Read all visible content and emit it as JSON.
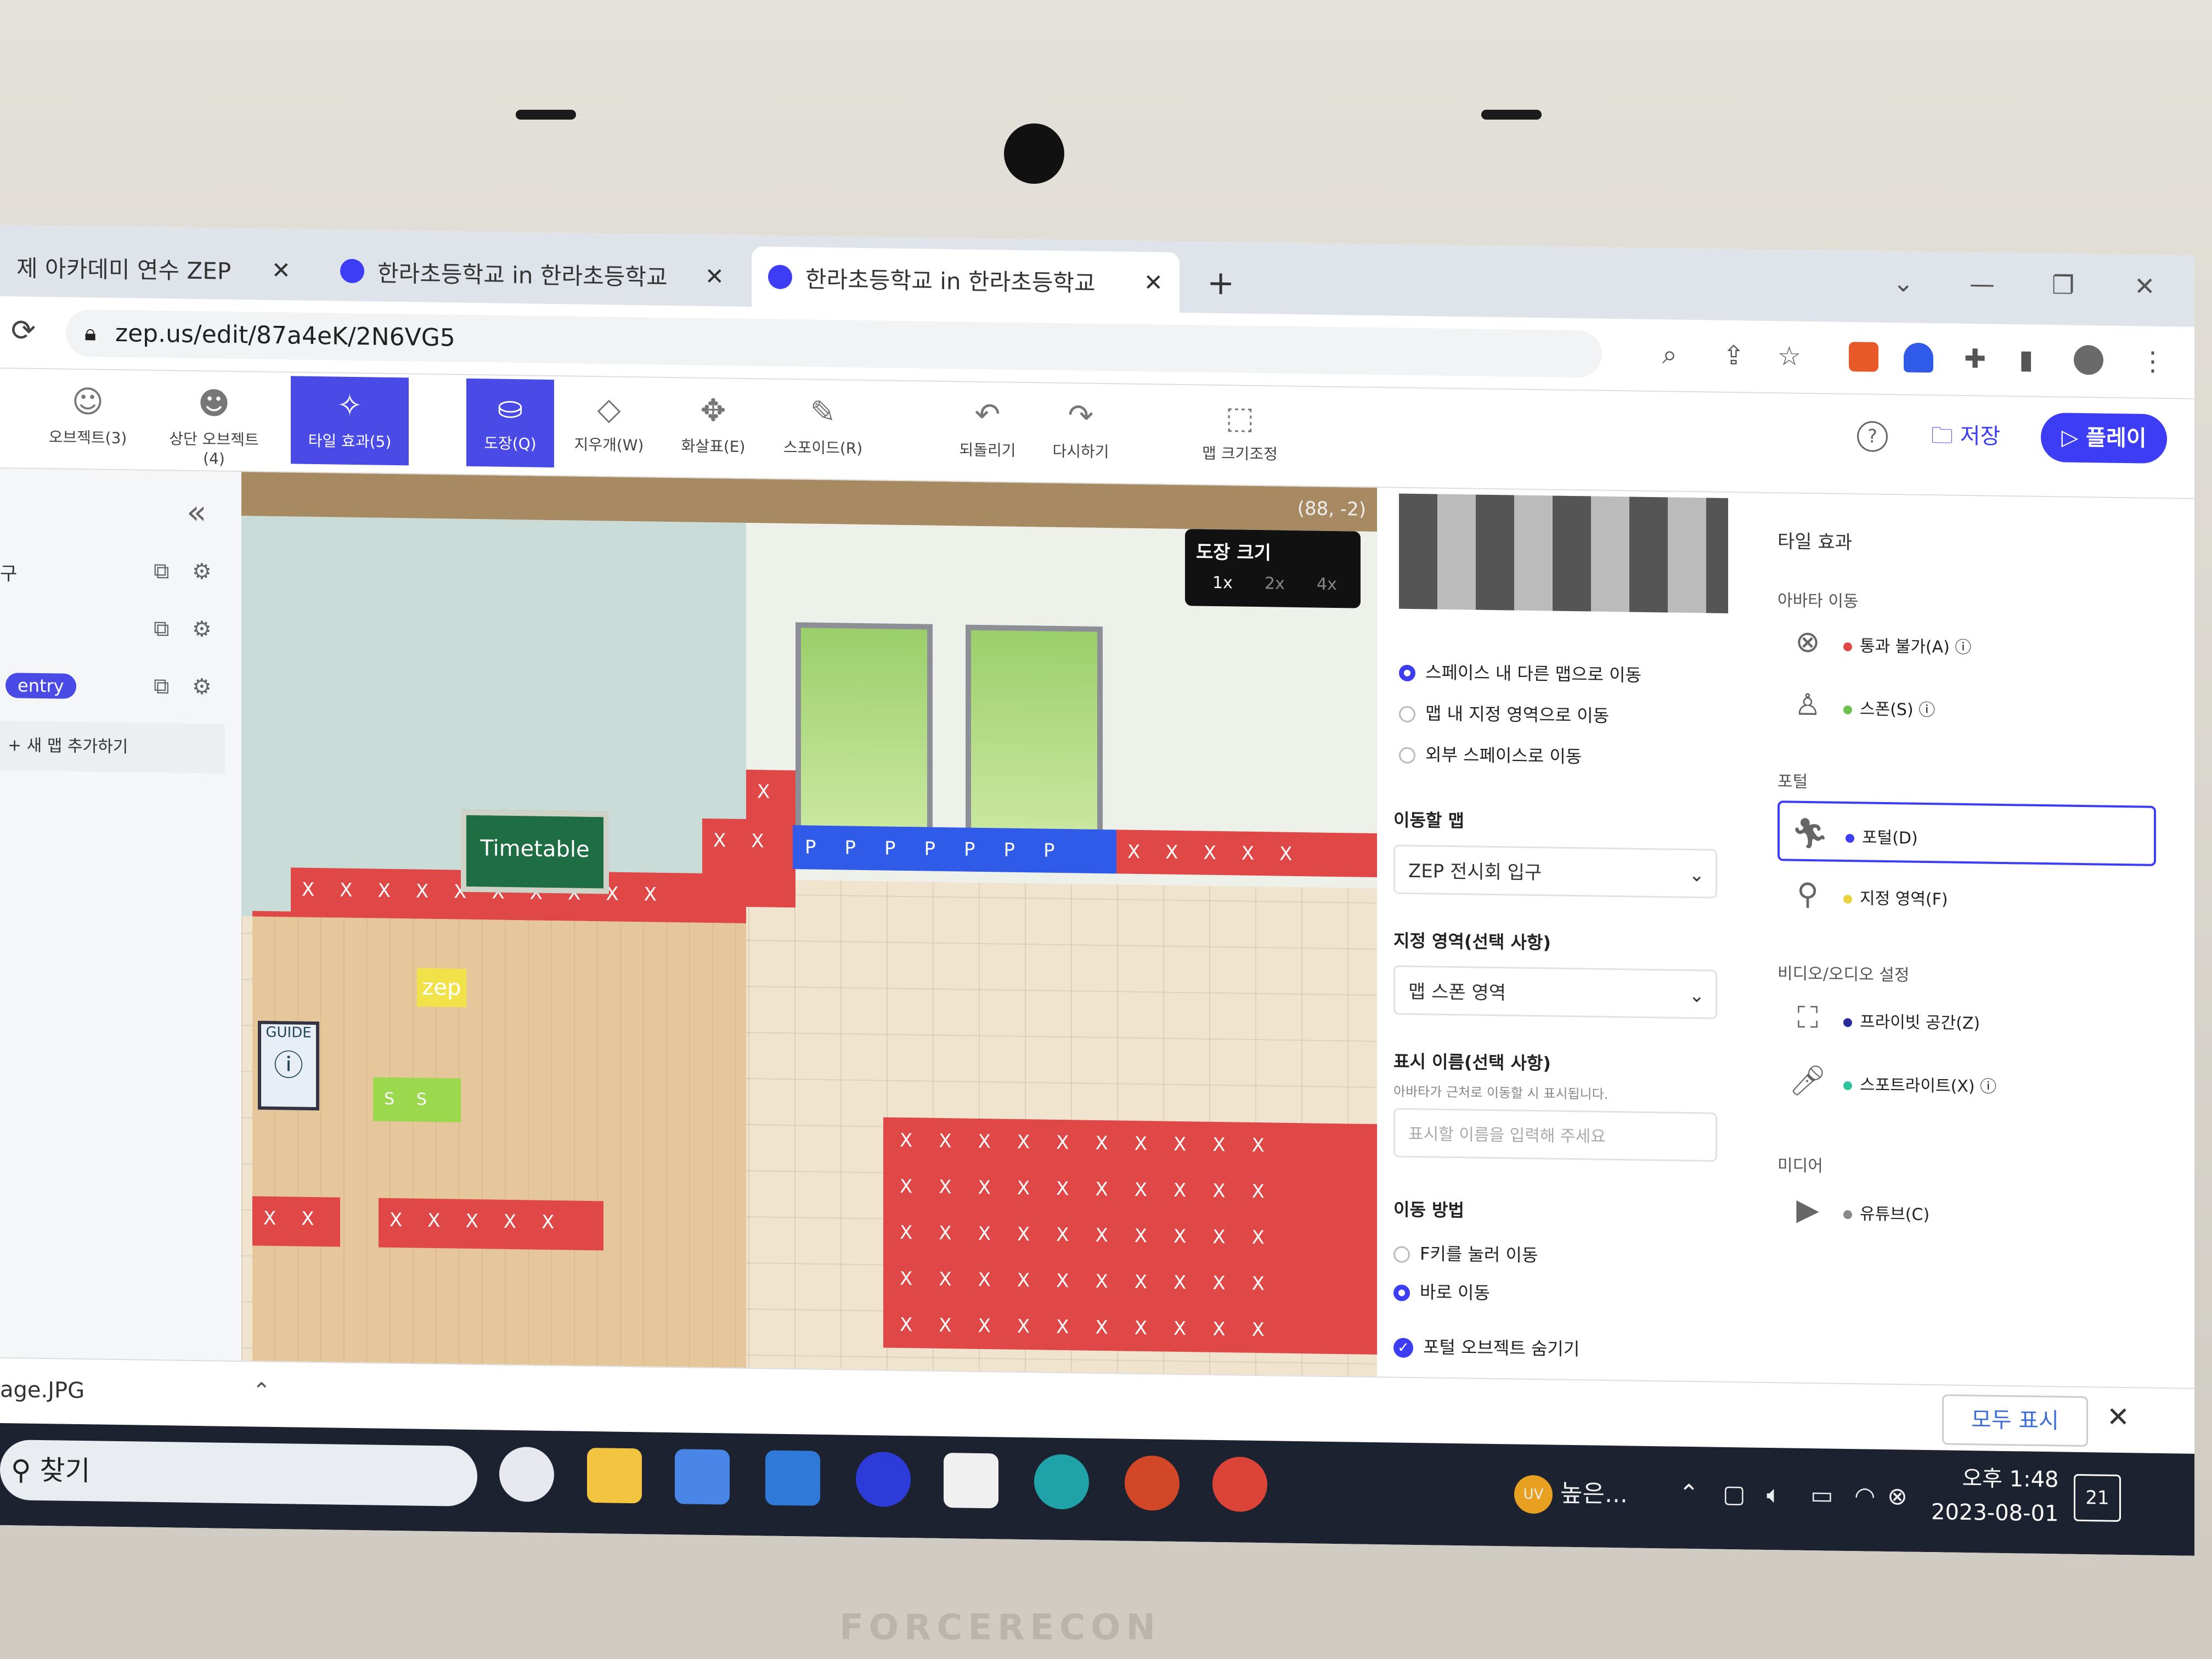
{
  "browser": {
    "tabs": [
      {
        "label": "제 아카데미 연수 ZEP",
        "close": "✕"
      },
      {
        "label": "한라초등학교 in 한라초등학교",
        "close": "✕"
      },
      {
        "label": "한라초등학교 in 한라초등학교",
        "close": "✕"
      }
    ],
    "new_tab": "+",
    "url": "zep.us/edit/87a4eK/2N6VG5"
  },
  "toolbar": {
    "tools": [
      {
        "label": "오브젝트(3)",
        "icon": "object-icon"
      },
      {
        "label": "상단 오브젝트(4)",
        "icon": "top-object-icon"
      },
      {
        "label": "타일 효과(5)",
        "icon": "tile-effect-icon",
        "selected": true
      },
      {
        "label": "도장(Q)",
        "icon": "stamp-icon",
        "selected": true
      },
      {
        "label": "지우개(W)",
        "icon": "eraser-icon"
      },
      {
        "label": "화살표(E)",
        "icon": "arrow-icon"
      },
      {
        "label": "스포이드(R)",
        "icon": "eyedropper-icon"
      },
      {
        "label": "되돌리기",
        "icon": "undo-icon"
      },
      {
        "label": "다시하기",
        "icon": "redo-icon"
      },
      {
        "label": "맵 크기조정",
        "icon": "map-resize-icon"
      }
    ],
    "save_label": "저장",
    "play_label": "플레이"
  },
  "left_panel": {
    "maps": [
      {
        "label": "구"
      },
      {
        "label": ""
      },
      {
        "label": "entry",
        "badge": true
      }
    ],
    "add_map": "+ 새 맵 추가하기"
  },
  "canvas": {
    "coordinate": "(88, -2)",
    "stamp_size": {
      "title": "도장 크기",
      "options": [
        "1x",
        "2x",
        "4x"
      ],
      "selected": "1x"
    },
    "timetable": "Timetable",
    "guide": "GUIDE",
    "zep_label": "zep",
    "portal_mark": "P",
    "spawn_mark": "S",
    "blocked_mark": "X"
  },
  "portal_settings": {
    "move_options": [
      {
        "label": "스페이스 내 다른 맵으로 이동",
        "checked": true
      },
      {
        "label": "맵 내 지정 영역으로 이동",
        "checked": false
      },
      {
        "label": "외부 스페이스로 이동",
        "checked": false
      }
    ],
    "target_map_label": "이동할 맵",
    "target_map_value": "ZEP 전시회 입구",
    "area_label": "지정 영역(선택 사항)",
    "area_value": "맵 스폰 영역",
    "display_name_label": "표시 이름(선택 사항)",
    "display_name_hint": "아바타가 근처로 이동할 시 표시됩니다.",
    "display_name_placeholder": "표시할 이름을 입력해 주세요",
    "move_method_label": "이동 방법",
    "move_methods": [
      {
        "label": "F키를 눌러 이동",
        "checked": false
      },
      {
        "label": "바로 이동",
        "checked": true
      }
    ],
    "hide_portal": "포털 오브젝트 숨기기"
  },
  "tile_effects": {
    "title": "타일 효과",
    "sections": [
      {
        "name": "아바타 이동",
        "items": [
          {
            "label": "통과 불가(A)",
            "color": "#e04848",
            "icon": "blocked-icon",
            "help": true
          },
          {
            "label": "스폰(S)",
            "color": "#6cc24a",
            "icon": "spawn-icon",
            "help": true
          }
        ]
      },
      {
        "name": "포털",
        "items": [
          {
            "label": "포털(D)",
            "color": "#3d3df5",
            "icon": "portal-icon",
            "selected": true
          },
          {
            "label": "지정 영역(F)",
            "color": "#e8d43a",
            "icon": "location-pin-icon"
          }
        ]
      },
      {
        "name": "비디오/오디오 설정",
        "items": [
          {
            "label": "프라이빗 공간(Z)",
            "color": "#2a2a9a",
            "icon": "private-space-icon"
          },
          {
            "label": "스포트라이트(X)",
            "color": "#2ec4a0",
            "icon": "spotlight-icon",
            "help": true
          }
        ]
      },
      {
        "name": "미디어",
        "items": [
          {
            "label": "유튜브(C)",
            "color": "#888888",
            "icon": "youtube-icon"
          }
        ]
      }
    ]
  },
  "download_bar": {
    "file": "age.JPG",
    "show_all": "모두 표시",
    "close": "✕"
  },
  "taskbar": {
    "search": "찾기",
    "weather": "높은...",
    "weather_badge": "UV",
    "time": "오후 1:48",
    "date": "2023-08-01",
    "notifications": "21"
  },
  "brand": "FORCERECON"
}
